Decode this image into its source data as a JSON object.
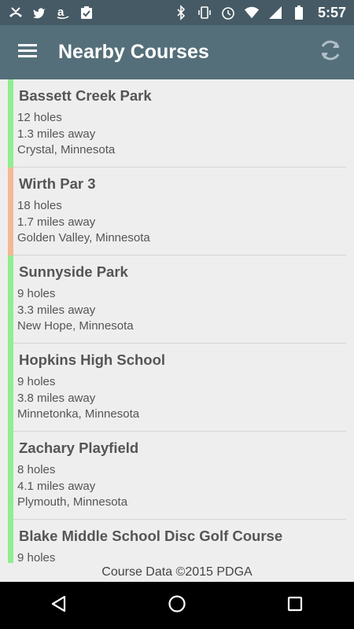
{
  "status_bar": {
    "time": "5:57",
    "left_icons": [
      "missed-call-icon",
      "twitter-icon",
      "amazon-icon",
      "clipboard-check-icon"
    ],
    "right_icons": [
      "bluetooth-icon",
      "vibrate-icon",
      "alarm-icon",
      "wifi-icon",
      "cell-signal-icon",
      "battery-icon"
    ]
  },
  "app_bar": {
    "title": "Nearby Courses",
    "menu_icon": "hamburger-menu-icon",
    "refresh_icon": "refresh-icon"
  },
  "courses": [
    {
      "name": "Bassett Creek Park",
      "holes": "12 holes",
      "distance": "1.3 miles away",
      "location": "Crystal, Minnesota",
      "color": "#90ee90"
    },
    {
      "name": "Wirth Par 3",
      "holes": "18 holes",
      "distance": "1.7 miles away",
      "location": "Golden Valley, Minnesota",
      "color": "#f5b895"
    },
    {
      "name": "Sunnyside Park",
      "holes": "9 holes",
      "distance": "3.3 miles away",
      "location": "New Hope, Minnesota",
      "color": "#90ee90"
    },
    {
      "name": "Hopkins High School",
      "holes": "9 holes",
      "distance": "3.8 miles away",
      "location": "Minnetonka, Minnesota",
      "color": "#90ee90"
    },
    {
      "name": "Zachary Playfield",
      "holes": "8 holes",
      "distance": "4.1 miles away",
      "location": "Plymouth, Minnesota",
      "color": "#90ee90"
    },
    {
      "name": "Blake Middle School Disc Golf Course",
      "holes": "9 holes",
      "distance": "",
      "location": "",
      "color": "#90ee90"
    }
  ],
  "footer": {
    "text": "Course Data ©2015 PDGA"
  },
  "nav_bar": {
    "icons": [
      "back-icon",
      "home-icon",
      "recents-icon"
    ]
  }
}
